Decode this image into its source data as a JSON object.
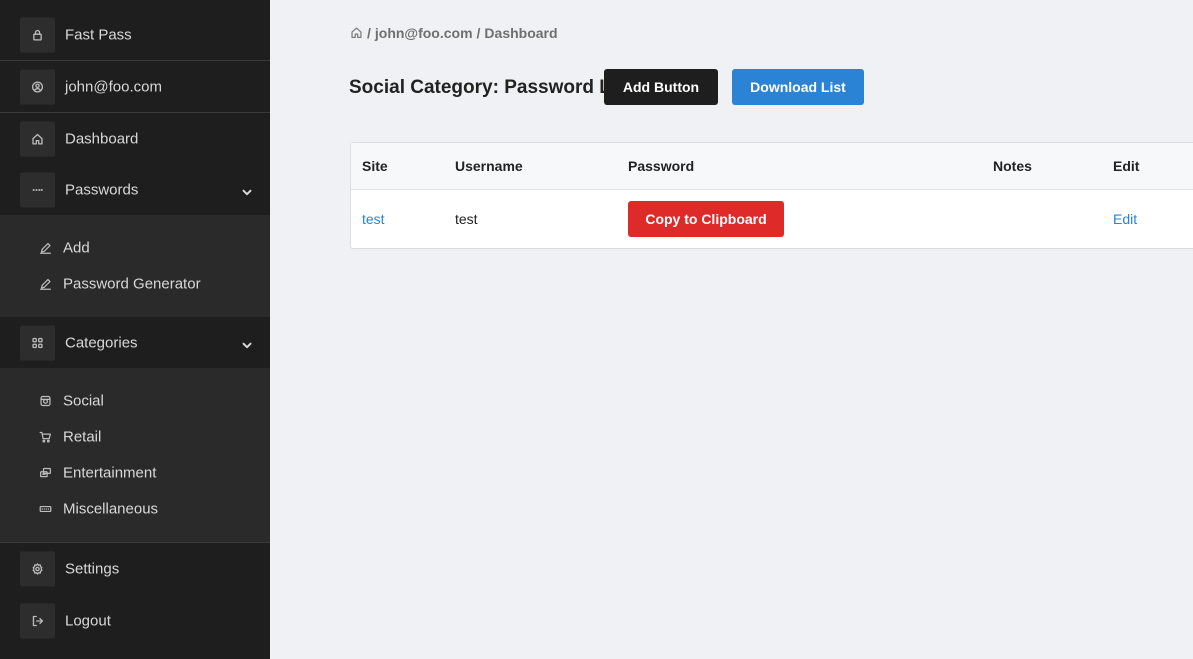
{
  "sidebar": {
    "brand": {
      "label": "Fast Pass",
      "icon": "lock-icon"
    },
    "user": {
      "label": "john@foo.com",
      "icon": "user-circle-icon"
    },
    "dashboard": {
      "label": "Dashboard",
      "icon": "home-icon"
    },
    "passwords": {
      "label": "Passwords",
      "icon": "dots-icon",
      "items": [
        {
          "label": "Add",
          "icon": "pencil-icon"
        },
        {
          "label": "Password Generator",
          "icon": "pencil-icon"
        }
      ]
    },
    "categories": {
      "label": "Categories",
      "icon": "grid-icon",
      "items": [
        {
          "label": "Social",
          "icon": "instagram-icon"
        },
        {
          "label": "Retail",
          "icon": "cart-icon"
        },
        {
          "label": "Entertainment",
          "icon": "ticket-icon"
        },
        {
          "label": "Miscellaneous",
          "icon": "keyboard-icon"
        }
      ]
    },
    "settings": {
      "label": "Settings",
      "icon": "gear-icon"
    },
    "logout": {
      "label": "Logout",
      "icon": "logout-icon"
    }
  },
  "breadcrumb": {
    "separator": "/",
    "user": "john@foo.com",
    "page": "Dashboard"
  },
  "header": {
    "title": "Social Category: Password List",
    "add_button": "Add Button",
    "download_button": "Download List"
  },
  "table": {
    "columns": [
      "Site",
      "Username",
      "Password",
      "Notes",
      "Edit"
    ],
    "rows": [
      {
        "site": "test",
        "username": "test",
        "password_action": "Copy to Clipboard",
        "notes": "",
        "edit": "Edit"
      }
    ]
  },
  "colors": {
    "sidebar_bg": "#1e1e1e",
    "submenu_bg": "#2a2a2a",
    "accent_blue": "#2a83d4",
    "danger_red": "#df2a2a",
    "page_bg": "#f0f1f5"
  }
}
